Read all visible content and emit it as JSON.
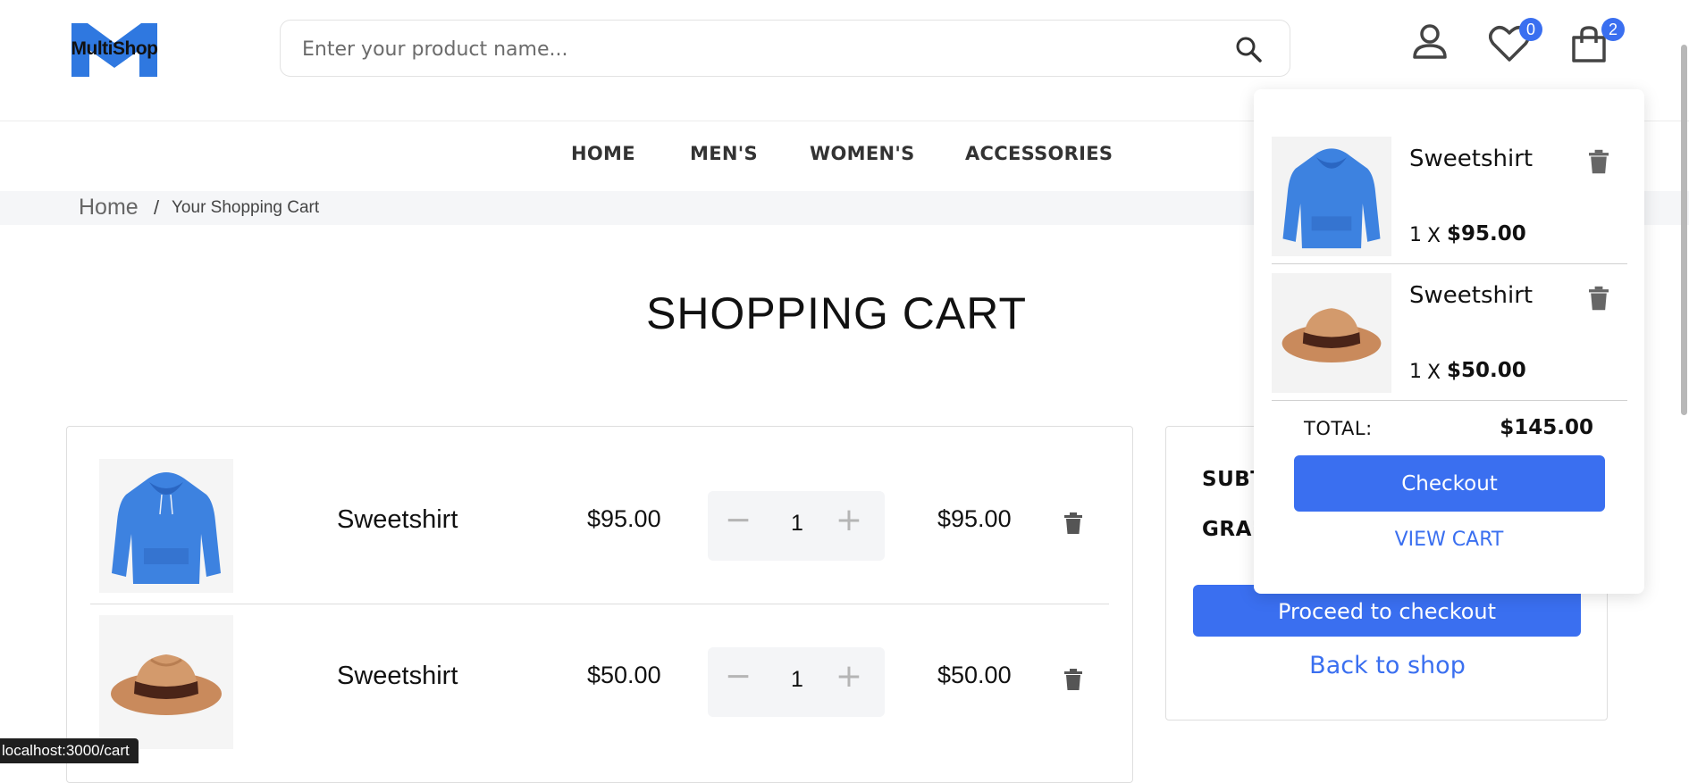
{
  "brand": {
    "logo_text": "MultiShop",
    "accent_color": "#3a6ff0"
  },
  "search": {
    "placeholder": "Enter your product name..."
  },
  "header": {
    "wishlist_count": "0",
    "cart_count": "2"
  },
  "nav": {
    "items": [
      "HOME",
      "MEN'S",
      "WOMEN'S",
      "ACCESSORIES"
    ]
  },
  "breadcrumb": {
    "home": "Home",
    "separator": "/",
    "current": "Your Shopping Cart"
  },
  "page": {
    "title": "SHOPPING CART"
  },
  "cart": {
    "items": [
      {
        "name": "Sweetshirt",
        "price": "$95.00",
        "quantity": "1",
        "minus": "−",
        "plus": "+",
        "total": "$95.00",
        "image": "blue-hoodie"
      },
      {
        "name": "Sweetshirt",
        "price": "$50.00",
        "quantity": "1",
        "minus": "−",
        "plus": "+",
        "total": "$50.00",
        "image": "brown-fedora-hat"
      }
    ]
  },
  "summary": {
    "subtotal_label": "SUBT",
    "grand_total_label": "GRAN",
    "proceed_label": "Proceed to checkout",
    "back_label": "Back to shop"
  },
  "mini_cart": {
    "items": [
      {
        "name": "Sweetshirt",
        "qty": "1",
        "x": "X",
        "price": "$95.00"
      },
      {
        "name": "Sweetshirt",
        "qty": "1",
        "x": "X",
        "price": "$50.00"
      }
    ],
    "total_label": "TOTAL:",
    "total_value": "$145.00",
    "checkout_label": "Checkout",
    "view_cart_label": "VIEW CART"
  },
  "status_bar": {
    "url": "localhost:3000/cart"
  }
}
